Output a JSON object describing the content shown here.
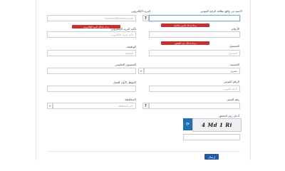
{
  "form": {
    "email_label": "البريد الإلكتروني",
    "email_placeholder": "example@domain.com",
    "email_error": "يرجى إدخال البريد الإلكتروني",
    "email_confirm_label": "تأكيد البريد الإلكتروني",
    "email_confirm_placeholder": "تأكيد البريد الإلكتروني",
    "email_confirm_error": "يرجى إدخال البريد الإلكتروني",
    "name_label": "الاسم من واقع بطاقة الرقم القومي",
    "name_placeholder": "",
    "name_error": "برجاء إدخال الاسم بالكامل",
    "phone_label": "الأرقام",
    "phone_placeholder": "",
    "phone_error": "برجاء إدخال رقم التليفون",
    "job_label": "الوظيفة",
    "job_placeholder": "الوظيفة",
    "mobile_label": "المحمول",
    "mobile_placeholder": "المحمول",
    "education_label": "المستوى التعليمي",
    "education_placeholder": "",
    "nationality_label": "الجنسية",
    "nationality_value": "مصري",
    "national_id_label": "الرقم القومي",
    "national_id_placeholder": "الرقم القومي",
    "degree_label": "المؤهل الأول للعمل",
    "degree_placeholder": "",
    "gov_label": "المحافظة",
    "gov_placeholder": "اختر المحافظة",
    "apt_label": "رقم المبنى",
    "apt_placeholder": "",
    "captcha_label": "أدخل رمز التحقق",
    "captcha_text": "4 Md 1 Ri",
    "captcha_input_placeholder": "",
    "submit_label": "إرسال",
    "help_symbol": "?",
    "refresh_symbol": "⟳"
  }
}
